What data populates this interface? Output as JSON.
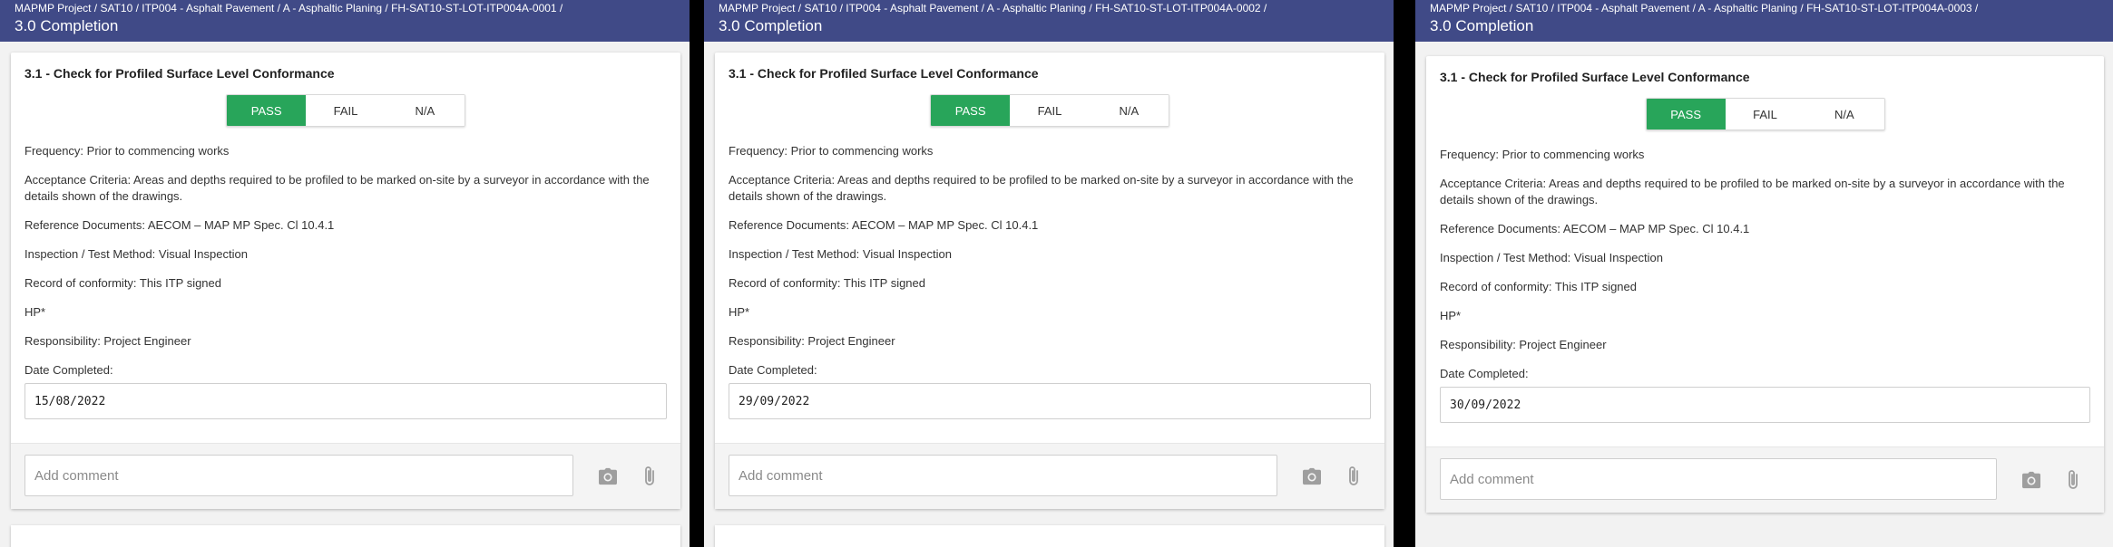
{
  "colors": {
    "header_bg": "#404a87",
    "pass_active": "#28a55a",
    "gutter": "#000000"
  },
  "panels": [
    {
      "breadcrumb": "MAPMP Project / SAT10 / ITP004 - Asphalt Pavement / A - Asphaltic Planing / FH-SAT10-ST-LOT-ITP004A-0001 /",
      "section": "3.0 Completion",
      "item_title": "3.1 - Check for Profiled Surface Level Conformance",
      "buttons": [
        "PASS",
        "FAIL",
        "N/A"
      ],
      "selected": "PASS",
      "frequency": "Frequency: Prior to commencing works",
      "acceptance": "Acceptance Criteria: Areas and depths required to be profiled to be marked on-site by a surveyor in accordance with the details shown of the drawings.",
      "reference": "Reference Documents: AECOM – MAP MP Spec. Cl 10.4.1",
      "method": "Inspection / Test Method: Visual Inspection",
      "record": "Record of conformity: This ITP signed",
      "hp": "HP*",
      "responsibility": "Responsibility: Project Engineer",
      "date_label": "Date Completed:",
      "date_value": "15/08/2022",
      "comment_placeholder": "Add comment"
    },
    {
      "breadcrumb": "MAPMP Project / SAT10 / ITP004 - Asphalt Pavement / A - Asphaltic Planing / FH-SAT10-ST-LOT-ITP004A-0002 /",
      "section": "3.0 Completion",
      "item_title": "3.1 - Check for Profiled Surface Level Conformance",
      "buttons": [
        "PASS",
        "FAIL",
        "N/A"
      ],
      "selected": "PASS",
      "frequency": "Frequency: Prior to commencing works",
      "acceptance": "Acceptance Criteria: Areas and depths required to be profiled to be marked on-site by a surveyor in accordance with the details shown of the drawings.",
      "reference": "Reference Documents: AECOM – MAP MP Spec. Cl 10.4.1",
      "method": "Inspection / Test Method: Visual Inspection",
      "record": "Record of conformity: This ITP signed",
      "hp": "HP*",
      "responsibility": "Responsibility: Project Engineer",
      "date_label": "Date Completed:",
      "date_value": "29/09/2022",
      "comment_placeholder": "Add comment"
    },
    {
      "breadcrumb": "MAPMP Project / SAT10 / ITP004 - Asphalt Pavement / A - Asphaltic Planing / FH-SAT10-ST-LOT-ITP004A-0003 /",
      "section": "3.0 Completion",
      "item_title": "3.1 - Check for Profiled Surface Level Conformance",
      "buttons": [
        "PASS",
        "FAIL",
        "N/A"
      ],
      "selected": "PASS",
      "frequency": "Frequency: Prior to commencing works",
      "acceptance": "Acceptance Criteria: Areas and depths required to be profiled to be marked on-site by a surveyor in accordance with the details shown of the drawings.",
      "reference": "Reference Documents: AECOM – MAP MP Spec. Cl 10.4.1",
      "method": "Inspection / Test Method: Visual Inspection",
      "record": "Record of conformity: This ITP signed",
      "hp": "HP*",
      "responsibility": "Responsibility: Project Engineer",
      "date_label": "Date Completed:",
      "date_value": "30/09/2022",
      "comment_placeholder": "Add comment"
    }
  ]
}
